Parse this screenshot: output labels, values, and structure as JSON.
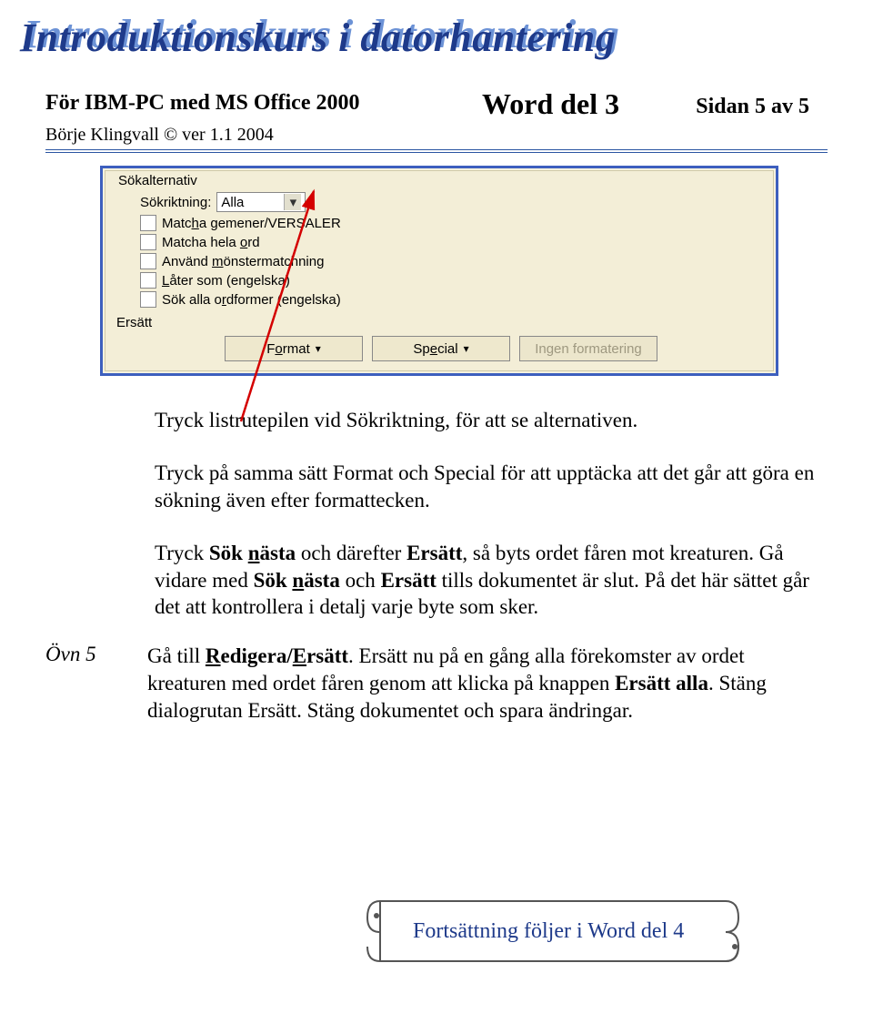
{
  "header": {
    "title": "Introduktionskurs i datorhantering",
    "line1": "För IBM-PC med MS Office 2000",
    "center": "Word del 3",
    "right": "Sidan 5 av 5",
    "sub": "Börje Klingvall  © ver 1.1 2004"
  },
  "dialog": {
    "group_label": "Sökalternativ",
    "direction_label": "Sökriktning:",
    "direction_value": "Alla",
    "check1_html": "Matc<u>h</u>a gemener/VERSALER",
    "check2_html": "Matcha hela <u>o</u>rd",
    "check3_html": "Använd <u>m</u>önstermatchning",
    "check4_html": "<u>L</u>åter som (engelska)",
    "check5_html": "Sök alla o<u>r</u>dformer (engelska)",
    "replace_label": "Ersätt",
    "btn_format_html": "F<u>o</u>rmat",
    "btn_special_html": "Sp<u>e</u>cial",
    "btn_noformat": "Ingen formatering"
  },
  "body": {
    "p1": "Tryck listrutepilen vid Sökriktning, för att se alternativen.",
    "p2": "Tryck på samma sätt Format och Special för att upptäcka att det går att göra en sökning även efter formattecken.",
    "p3_html": "Tryck <b>Sök <u>n</u>ästa</b> och därefter <b>Ersätt</b>, så byts ordet fåren mot kreaturen. Gå vidare med <b>Sök <u>n</u>ästa</b> och <b>Ersätt</b> tills dokumentet är slut. På det här sättet går det att kontrollera i detalj varje byte som sker.",
    "ovn_label": "Övn 5",
    "p4_html": "Gå till <b><u>R</u>edigera/<u>E</u>rsätt</b>. Ersätt nu på en gång alla förekomster av ordet kreaturen med ordet fåren genom att klicka på knappen <b>Ersätt alla</b>. Stäng dialogrutan Ersätt. Stäng dokumentet och spara ändringar."
  },
  "banner": {
    "text": "Fortsättning följer i Word del 4"
  }
}
